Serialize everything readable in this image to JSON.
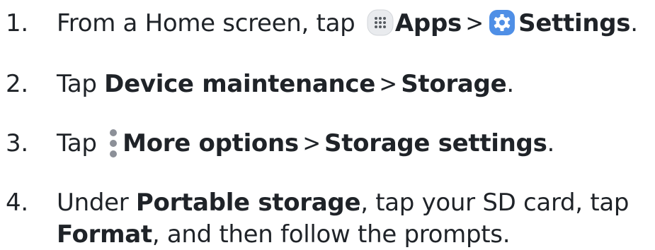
{
  "steps": [
    {
      "number": "1.",
      "prefix": "From a Home screen, tap ",
      "apps_icon": "apps-grid-icon",
      "apps_label": "Apps",
      "separator": ">",
      "settings_icon": "gear-icon",
      "settings_label": "Settings",
      "suffix": "."
    },
    {
      "number": "2.",
      "prefix": "Tap ",
      "bold1": "Device maintenance",
      "separator": ">",
      "bold2": "Storage",
      "suffix": "."
    },
    {
      "number": "3.",
      "prefix": "Tap ",
      "more_icon": "more-options-vertical-icon",
      "bold1": "More options",
      "separator": ">",
      "bold2": "Storage settings",
      "suffix": "."
    },
    {
      "number": "4.",
      "prefix": "Under ",
      "bold1": "Portable storage",
      "middle": ", tap your SD card, tap",
      "bold2": "Format",
      "suffix": ", and then follow the prompts."
    }
  ],
  "colors": {
    "text": "#1f2328",
    "settings_icon_bg": "#4f8fe6",
    "apps_icon_bg": "#e9ebee",
    "more_dots": "#8c9098"
  }
}
